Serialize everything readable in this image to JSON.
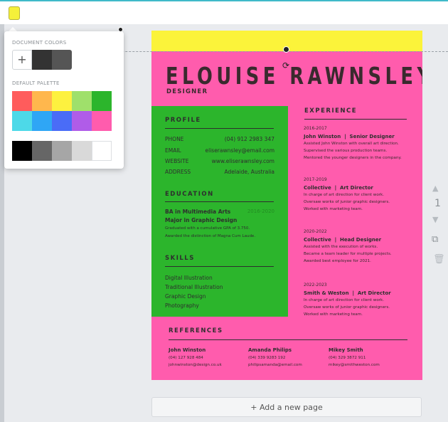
{
  "toolbar": {
    "text_color_icon": "color-swatch-icon",
    "text_color_value": "#f5f03a"
  },
  "color_popup": {
    "document_colors_label": "DOCUMENT COLORS",
    "add_label": "+",
    "document_colors": [
      "#333333",
      "#555555"
    ],
    "default_palette_label": "DEFAULT PALETTE",
    "palette_row1": [
      "#ff5c5c",
      "#ffb74d",
      "#fdf13f",
      "#9fe06b",
      "#2cb52c"
    ],
    "palette_row2": [
      "#4dd9e8",
      "#2fa6f5",
      "#4a6cf7",
      "#b05ce8",
      "#ff5cad"
    ],
    "grays": [
      "#000000",
      "#666666",
      "#a6a6a6",
      "#d9d9d9",
      "#ffffff"
    ]
  },
  "resume": {
    "name": "ELOUISE RAWNSLEY",
    "role": "DESIGNER",
    "profile": {
      "title": "PROFILE",
      "rows": [
        {
          "label": "PHONE",
          "value": "(04) 912 2983 347"
        },
        {
          "label": "EMAIL",
          "value": "eliserawnsley@email.com"
        },
        {
          "label": "WEBSITE",
          "value": "www.eliserawnsley.com"
        },
        {
          "label": "ADDRESS",
          "value": "Adelaide, Australia"
        }
      ]
    },
    "education": {
      "title": "EDUCATION",
      "degree_line1": "BA in Multimedia Arts",
      "degree_line2": "Major in Graphic Design",
      "years": "2016-2020",
      "desc1": "Graduated with a cumulative GPA of 3.750.",
      "desc2": "Awarded the distinction of Magna Cum Laude."
    },
    "skills": {
      "title": "SKILLS",
      "items": [
        "Digital Illustration",
        "Traditional Illustration",
        "Graphic Design",
        "Photography"
      ]
    },
    "experience": {
      "title": "EXPERIENCE",
      "items": [
        {
          "date": "2016-2017",
          "company": "John Winston",
          "role": "Senior Designer",
          "desc": [
            "Assisted John Winston with overall art direction.",
            "Supervised the various production teams.",
            "Mentored the younger designers in the company."
          ]
        },
        {
          "date": "2017-2019",
          "company": "Collective",
          "role": "Art Director",
          "desc": [
            "In charge of art direction for client work.",
            "Oversaw works of junior graphic designers.",
            "Worked with marketing team."
          ]
        },
        {
          "date": "2020-2022",
          "company": "Collective",
          "role": "Head Designer",
          "desc": [
            "Assisted with the execution of works.",
            "Became a team leader for multiple projects.",
            "Awarded best employee for 2021."
          ]
        },
        {
          "date": "2022-2023",
          "company": "Smith & Weston",
          "role": "Art Director",
          "desc": [
            "In charge of art direction for client work.",
            "Oversaw works of junior graphic designers.",
            "Worked with marketing team."
          ]
        }
      ]
    },
    "references": {
      "title": "REFERENCES",
      "people": [
        {
          "name": "John Winston",
          "phone": "(04) 127 928 484",
          "email": "johnwinston@design.co.uk"
        },
        {
          "name": "Amanda Philips",
          "phone": "(04) 339 9283 192",
          "email": "philipsamanda@email.com"
        },
        {
          "name": "Mikey Smith",
          "phone": "(04) 329 3872 911",
          "email": "mikey@smithweston.com"
        }
      ]
    },
    "colors": {
      "page_pink": "#ff5cad",
      "band_yellow": "#fbf33a",
      "profile_green": "#2cb52c"
    }
  },
  "side_tools": {
    "page_number": "1",
    "up_icon": "chevron-up-icon",
    "down_icon": "chevron-down-icon",
    "copy_icon": "copy-page-icon",
    "delete_icon": "trash-icon"
  },
  "add_page_label": "+ Add a new page"
}
